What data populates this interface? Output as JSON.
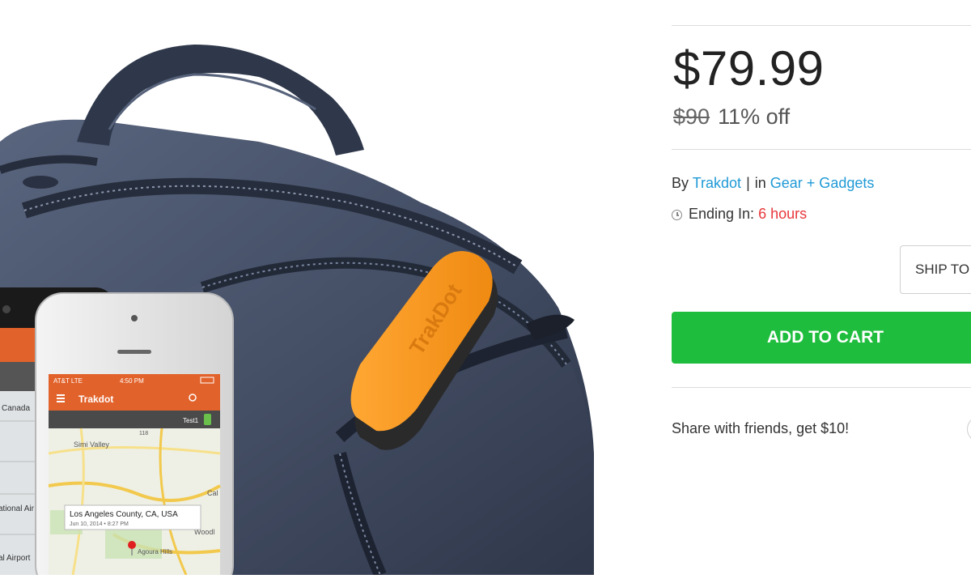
{
  "price": {
    "current": "$79.99",
    "original": "$90",
    "discount": "11% off"
  },
  "seller": {
    "by_label": "By",
    "vendor": "Trakdot",
    "separator": "|",
    "in_label": "in",
    "category": "Gear + Gadgets"
  },
  "ending": {
    "label": "Ending In:",
    "value": "6 hours"
  },
  "buttons": {
    "ship_to": "SHIP TO",
    "add_to_cart": "ADD TO CART"
  },
  "share": {
    "text": "Share with friends, get $10!"
  },
  "colors": {
    "cart_green": "#1fbd3d",
    "link_blue": "#1f9ad6",
    "ending_red": "#e8373b",
    "trakdot_orange": "#f7941d"
  },
  "product_image": {
    "phone_front": {
      "status_carrier": "AT&T  LTE",
      "status_time": "4:50 PM",
      "app_title": "Trakdot",
      "test_label": "Test1",
      "map_labels": [
        "Simi Valley",
        "Woodl",
        "Cal",
        "Agoura Hills",
        "118"
      ],
      "popup_title": "Los Angeles County, CA, USA",
      "popup_date": "Jun 10, 2014 • 8:27 PM"
    },
    "phone_back": {
      "list_items": [
        "Canada",
        "ational Air",
        "al Airport"
      ]
    },
    "device_text": "TrakDot"
  }
}
